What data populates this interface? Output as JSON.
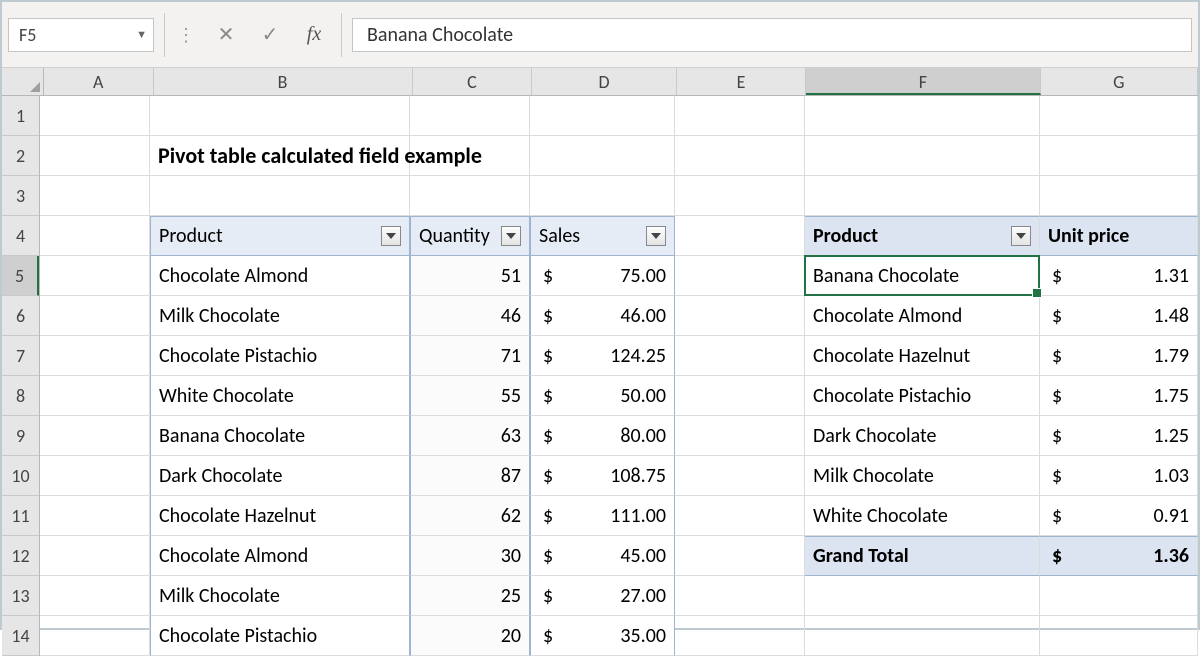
{
  "nameBox": "F5",
  "formula": "Banana Chocolate",
  "columns": [
    "A",
    "B",
    "C",
    "D",
    "E",
    "F",
    "G"
  ],
  "activeCol": "F",
  "activeRow": 5,
  "rowCount": 14,
  "title": "Pivot table calculated field example",
  "leftTable": {
    "headers": {
      "product": "Product",
      "quantity": "Quantity",
      "sales": "Sales"
    },
    "rows": [
      {
        "product": "Chocolate Almond",
        "quantity": 51,
        "sales": "75.00"
      },
      {
        "product": "Milk Chocolate",
        "quantity": 46,
        "sales": "46.00"
      },
      {
        "product": "Chocolate Pistachio",
        "quantity": 71,
        "sales": "124.25"
      },
      {
        "product": "White Chocolate",
        "quantity": 55,
        "sales": "50.00"
      },
      {
        "product": "Banana Chocolate",
        "quantity": 63,
        "sales": "80.00"
      },
      {
        "product": "Dark Chocolate",
        "quantity": 87,
        "sales": "108.75"
      },
      {
        "product": "Chocolate Hazelnut",
        "quantity": 62,
        "sales": "111.00"
      },
      {
        "product": "Chocolate Almond",
        "quantity": 30,
        "sales": "45.00"
      },
      {
        "product": "Milk Chocolate",
        "quantity": 25,
        "sales": "27.00"
      },
      {
        "product": "Chocolate Pistachio",
        "quantity": 20,
        "sales": "35.00"
      }
    ]
  },
  "pivot": {
    "headers": {
      "product": "Product",
      "price": "Unit price"
    },
    "rows": [
      {
        "product": "Banana Chocolate",
        "price": "1.31"
      },
      {
        "product": "Chocolate Almond",
        "price": "1.48"
      },
      {
        "product": "Chocolate Hazelnut",
        "price": "1.79"
      },
      {
        "product": "Chocolate Pistachio",
        "price": "1.75"
      },
      {
        "product": "Dark Chocolate",
        "price": "1.25"
      },
      {
        "product": "Milk Chocolate",
        "price": "1.03"
      },
      {
        "product": "White Chocolate",
        "price": "0.91"
      }
    ],
    "grandTotal": {
      "label": "Grand Total",
      "price": "1.36"
    }
  },
  "currency": "$"
}
